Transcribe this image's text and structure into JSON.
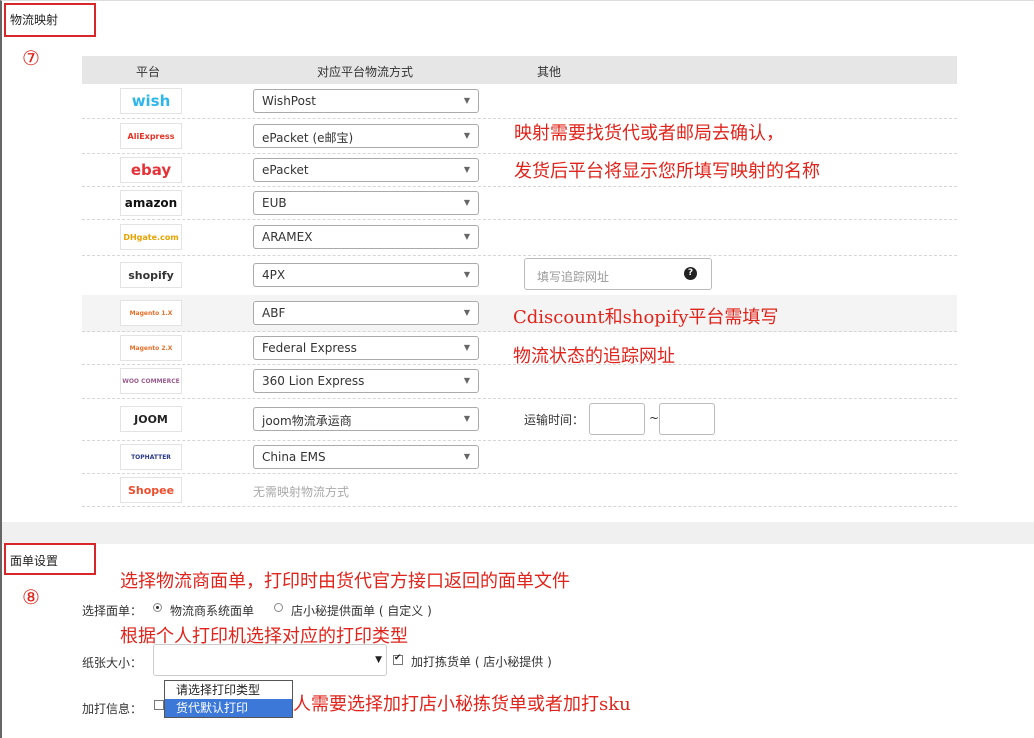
{
  "logistics_section": {
    "title": "物流映射",
    "step_marker": "⑦",
    "headers": {
      "platform": "平台",
      "method": "对应平台物流方式",
      "other": "其他"
    },
    "rows": [
      {
        "platform": "wish",
        "logo_text": "wish",
        "logo_color": "#2fb7ec",
        "method": "WishPost"
      },
      {
        "platform": "aliexpress",
        "logo_text": "AliExpress",
        "logo_color": "#e43225",
        "method": "ePacket (e邮宝)"
      },
      {
        "platform": "ebay",
        "logo_text": "ebay",
        "logo_color": "#e53238",
        "method": "ePacket"
      },
      {
        "platform": "amazon",
        "logo_text": "amazon",
        "logo_color": "#111111",
        "method": "EUB"
      },
      {
        "platform": "dhgate",
        "logo_text": "DHgate.com",
        "logo_color": "#e7a300",
        "method": "ARAMEX"
      },
      {
        "platform": "shopify",
        "logo_text": "shopify",
        "logo_color": "#333333",
        "method": "4PX"
      },
      {
        "platform": "magento1",
        "logo_text": "Magento 1.X",
        "logo_color": "#e66e28",
        "method": "ABF"
      },
      {
        "platform": "magento2",
        "logo_text": "Magento 2.X",
        "logo_color": "#e66e28",
        "method": "Federal Express"
      },
      {
        "platform": "woocommerce",
        "logo_text": "WOO COMMERCE",
        "logo_color": "#9b5c8f",
        "method": "360 Lion Express"
      },
      {
        "platform": "joom",
        "logo_text": "JOOM",
        "logo_color": "#222222",
        "method": "joom物流承运商"
      },
      {
        "platform": "tophatter",
        "logo_text": "TOPHATTER",
        "logo_color": "#2a3a8a",
        "method": "China EMS"
      },
      {
        "platform": "shopee",
        "logo_text": "Shopee",
        "logo_color": "#ee4d2d",
        "method": ""
      }
    ],
    "no_mapping_text": "无需映射物流方式",
    "tracking_url_placeholder": "填写追踪网址",
    "help_icon": "question-circle-icon",
    "transit_time_label": "运输时间：",
    "range_separator": "~",
    "annotations": {
      "a1": "映射需要找货代或者邮局去确认，",
      "a2": "发货后平台将显示您所填写映射的名称",
      "a3": "Cdiscount和shopify平台需填写",
      "a4": "物流状态的追踪网址"
    }
  },
  "label_section": {
    "title": "面单设置",
    "step_marker": "⑧",
    "annotation_top": "选择物流商面单，打印时由货代官方接口返回的面单文件",
    "select_label": "选择面单：",
    "option_carrier": "物流商系统面单",
    "option_custom": "店小秘提供面单 ( 自定义 )",
    "annotation_mid": "根据个人打印机选择对应的打印类型",
    "paper_size_label": "纸张大小：",
    "print_pick_list": "加打拣货单 ( 店小秘提供 )",
    "extra_print_label": "加打信息：",
    "dropdown_options": [
      "请选择打印类型",
      "货代默认打印"
    ],
    "annotation_bottom": "人需要选择加打店小秘拣货单或者加打sku"
  },
  "colors": {
    "annotation": "#e0241b",
    "dropdown_highlight": "#3b78d8",
    "header_bg": "#e6e6e6"
  }
}
